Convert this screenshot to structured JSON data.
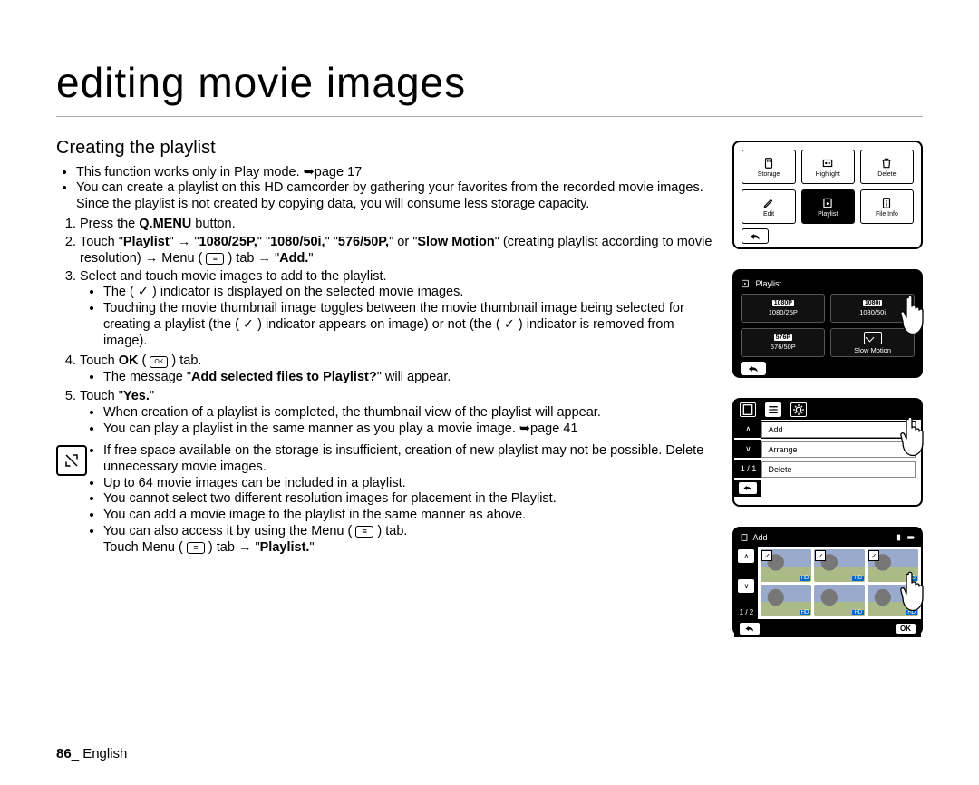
{
  "page": {
    "title": "editing movie images",
    "section_title": "Creating the playlist",
    "footer_page": "86",
    "footer_sep": "_ ",
    "footer_lang": "English"
  },
  "intro": {
    "b1": "This function works only in Play mode. ➥page 17",
    "b2": "You can create a playlist on this HD camcorder by gathering your favorites from the recorded movie images. Since the playlist is not created by copying data, you will consume less storage capacity."
  },
  "steps": {
    "s1_a": "Press the ",
    "s1_b": "Q.MENU",
    "s1_c": " button.",
    "s2_a": "Touch \"",
    "s2_b": "Playlist",
    "s2_c": "\" → \"",
    "s2_d": "1080/25P,",
    "s2_e": "\" \"",
    "s2_f": "1080/50i,",
    "s2_g": "\" \"",
    "s2_h": "576/50P,",
    "s2_i": "\" or \"",
    "s2_j": "Slow Motion",
    "s2_k": "\" (creating playlist according to movie resolution) → Menu ( ",
    "s2_icon": "≡",
    "s2_l": " ) tab → \"",
    "s2_m": "Add.",
    "s2_n": "\"",
    "s3": "Select and touch movie images to add to the playlist.",
    "s3_b1": "The ( ✓ ) indicator is displayed on the selected movie images.",
    "s3_b2": "Touching the movie thumbnail image toggles between the movie thumbnail image being selected for creating a playlist (the ( ✓ ) indicator appears on image) or not (the ( ✓ ) indicator is removed from image).",
    "s4_a": "Touch ",
    "s4_b": "OK",
    "s4_c": " ( ",
    "s4_icon": "OK",
    "s4_d": " ) tab.",
    "s4_b1a": "The message \"",
    "s4_b1b": "Add selected files to Playlist?",
    "s4_b1c": "\" will appear.",
    "s5_a": "Touch \"",
    "s5_b": "Yes.",
    "s5_c": "\"",
    "s5_b1": "When creation of a playlist is completed, the thumbnail view of the playlist will appear.",
    "s5_b2": "You can play a playlist in the same manner as you play a movie image. ➥page 41"
  },
  "notes": {
    "n1": "If free space available on the storage is insufficient, creation of new playlist may not be possible. Delete unnecessary movie images.",
    "n2": "Up to 64 movie images can be included in a playlist.",
    "n3": "You cannot select two different resolution images for placement in the Playlist.",
    "n4": "You can add a movie image to the playlist in the same manner as above.",
    "n5_a": "You can also access it by using the Menu ( ",
    "n5_icon": "≡",
    "n5_b": " ) tab.",
    "n5_c": "Touch Menu ( ",
    "n5_d": " ) tab → \"",
    "n5_e": "Playlist.",
    "n5_f": "\""
  },
  "screen1": {
    "c1": "Storage",
    "c2": "Highlight",
    "c3": "Delete",
    "c4": "Edit",
    "c5": "Playlist",
    "c6": "File Info"
  },
  "screen2": {
    "title": "Playlist",
    "o1t": "1080P",
    "o1l": "1080/25P",
    "o2t": "1080i",
    "o2l": "1080/50i",
    "o3t": "576P",
    "o3l": "576/50P",
    "o4l": "Slow Motion"
  },
  "screen3": {
    "r1": "Add",
    "r2": "Arrange",
    "r3": "Delete",
    "page": "1 / 1"
  },
  "screen4": {
    "title": "Add",
    "hd": "HD",
    "page": "1 / 2",
    "ok": "OK"
  }
}
